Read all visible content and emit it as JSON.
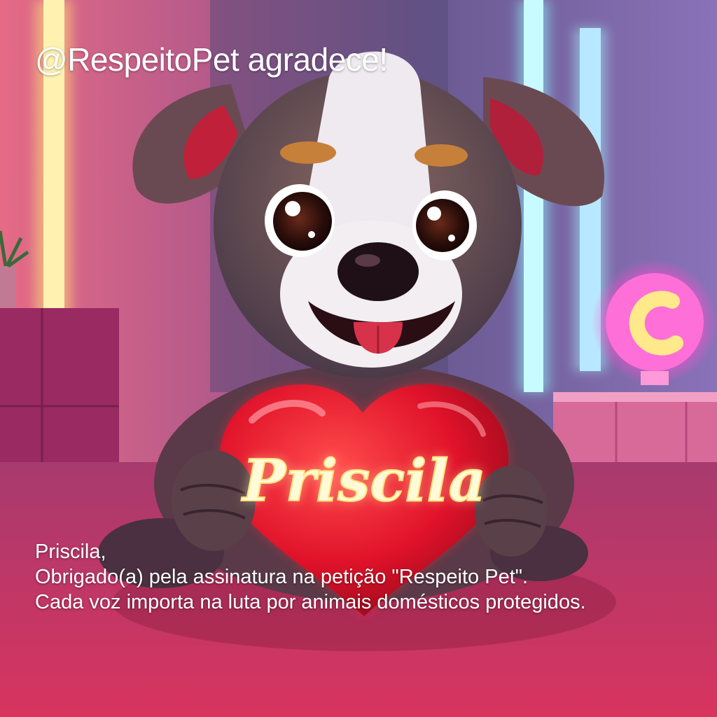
{
  "header": {
    "title": "@RespeitoPet agradece!"
  },
  "heart": {
    "name": "Priscila"
  },
  "message": {
    "line1": "Priscila,",
    "line2": "Obrigado(a) pela assinatura na petição \"Respeito Pet\".",
    "line3": "Cada voz importa na luta por animais domésticos protegidos."
  },
  "colors": {
    "heart": "#e0122a",
    "neon_yellow": "#ffe27a",
    "neon_cyan": "#8ef6ff",
    "neon_pink": "#ff4fd0",
    "floor": "#c43566"
  },
  "icons": [
    "puppy-illustration",
    "heart-icon",
    "neon-lamp-icon",
    "plant-icon"
  ]
}
